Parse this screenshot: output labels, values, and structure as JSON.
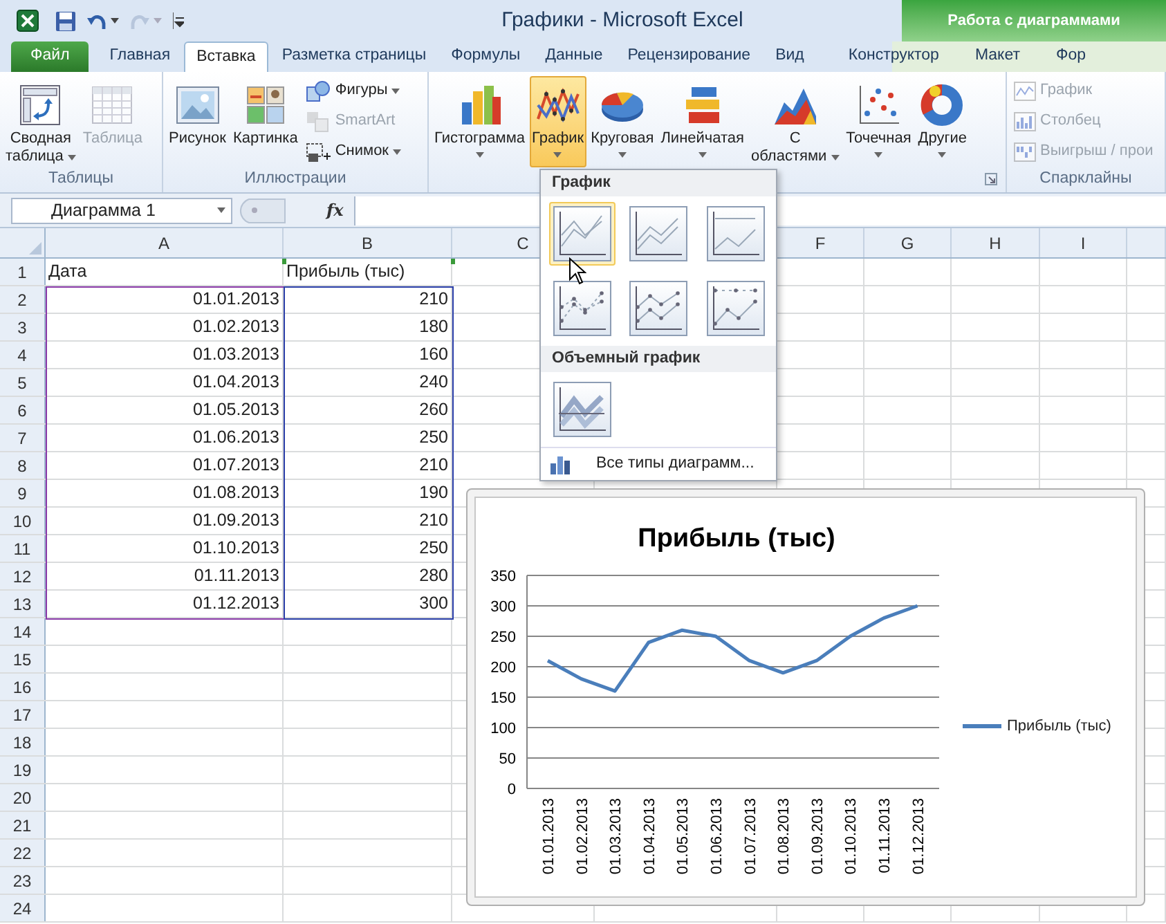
{
  "window": {
    "title": "Графики - Microsoft Excel",
    "context_header": "Работа с диаграммами"
  },
  "tabs": [
    {
      "label": "Файл",
      "kind": "file",
      "selected": false
    },
    {
      "label": "Главная",
      "kind": "normal",
      "selected": false
    },
    {
      "label": "Вставка",
      "kind": "normal",
      "selected": true
    },
    {
      "label": "Разметка страницы",
      "kind": "normal",
      "selected": false
    },
    {
      "label": "Формулы",
      "kind": "normal",
      "selected": false
    },
    {
      "label": "Данные",
      "kind": "normal",
      "selected": false
    },
    {
      "label": "Рецензирование",
      "kind": "normal",
      "selected": false
    },
    {
      "label": "Вид",
      "kind": "normal",
      "selected": false
    },
    {
      "label": "Конструктор",
      "kind": "context",
      "selected": false
    },
    {
      "label": "Макет",
      "kind": "context",
      "selected": false
    },
    {
      "label": "Фор",
      "kind": "context",
      "selected": false
    }
  ],
  "ribbon": {
    "groups": [
      {
        "label": "Таблицы",
        "items": [
          {
            "label": "Сводная\nтаблица",
            "kind": "large",
            "menu": true,
            "disabled": false,
            "selected": false
          },
          {
            "label": "Таблица",
            "kind": "large",
            "disabled": true,
            "selected": false
          }
        ]
      },
      {
        "label": "Иллюстрации",
        "items": [
          {
            "label": "Рисунок",
            "kind": "large",
            "disabled": false,
            "selected": false
          },
          {
            "label": "Картинка",
            "kind": "large",
            "disabled": false,
            "selected": false
          },
          {
            "label": "Фигуры",
            "kind": "small",
            "menu": true,
            "disabled": false
          },
          {
            "label": "SmartArt",
            "kind": "small",
            "disabled": true
          },
          {
            "label": "Снимок",
            "kind": "small",
            "menu": true,
            "disabled": false
          }
        ]
      },
      {
        "launcher": true,
        "items": [
          {
            "label": "Гистограмма",
            "kind": "large",
            "menu": true,
            "disabled": false,
            "selected": false
          },
          {
            "label": "График",
            "kind": "large",
            "menu": true,
            "disabled": false,
            "selected": true
          },
          {
            "label": "Круговая",
            "kind": "large",
            "menu": true,
            "disabled": false,
            "selected": false
          },
          {
            "label": "Линейчатая",
            "kind": "large",
            "menu": true,
            "disabled": false,
            "selected": false
          },
          {
            "label": "С\nобластями",
            "kind": "large",
            "menu": true,
            "disabled": false,
            "selected": false
          },
          {
            "label": "Точечная",
            "kind": "large",
            "menu": true,
            "disabled": false,
            "selected": false
          },
          {
            "label": "Другие",
            "kind": "large",
            "menu": true,
            "disabled": false,
            "selected": false
          }
        ]
      },
      {
        "label": "Спарклайны",
        "items": [
          {
            "label": "График",
            "kind": "small",
            "disabled": true
          },
          {
            "label": "Столбец",
            "kind": "small",
            "disabled": true
          },
          {
            "label": "Выигрыш / прои",
            "kind": "small",
            "disabled": true
          }
        ]
      }
    ]
  },
  "formula_bar": {
    "name_box": "Диаграмма 1",
    "fx": "fx"
  },
  "sheet": {
    "columns": [
      {
        "label": "A"
      },
      {
        "label": "B"
      },
      {
        "label": "C"
      },
      {
        "label": "F"
      },
      {
        "label": "G"
      },
      {
        "label": "H"
      },
      {
        "label": "I"
      }
    ],
    "row_numbers": [
      "1",
      "2",
      "3",
      "4",
      "5",
      "6",
      "7",
      "8",
      "9",
      "10",
      "11",
      "12",
      "13",
      "14",
      "15",
      "16",
      "17",
      "18",
      "19",
      "20",
      "21",
      "22",
      "23",
      "24"
    ],
    "rows": [
      [
        "Дата",
        "Прибыль (тыс)"
      ],
      [
        "01.01.2013",
        "210"
      ],
      [
        "01.02.2013",
        "180"
      ],
      [
        "01.03.2013",
        "160"
      ],
      [
        "01.04.2013",
        "240"
      ],
      [
        "01.05.2013",
        "260"
      ],
      [
        "01.06.2013",
        "250"
      ],
      [
        "01.07.2013",
        "210"
      ],
      [
        "01.08.2013",
        "190"
      ],
      [
        "01.09.2013",
        "210"
      ],
      [
        "01.10.2013",
        "250"
      ],
      [
        "01.11.2013",
        "280"
      ],
      [
        "01.12.2013",
        "300"
      ]
    ]
  },
  "dropdown": {
    "sections": [
      {
        "title": "График",
        "options": [
          {
            "selected": true
          },
          {
            "selected": false
          },
          {
            "selected": false
          },
          {
            "selected": false
          },
          {
            "selected": false
          },
          {
            "selected": false
          }
        ]
      },
      {
        "title": "Объемный график",
        "options": [
          {
            "selected": false
          }
        ]
      }
    ],
    "footer": "Все типы диаграмм..."
  },
  "chart": {
    "chart_data": {
      "type": "line",
      "title": "Прибыль (тыс)",
      "categories": [
        "01.01.2013",
        "01.02.2013",
        "01.03.2013",
        "01.04.2013",
        "01.05.2013",
        "01.06.2013",
        "01.07.2013",
        "01.08.2013",
        "01.09.2013",
        "01.10.2013",
        "01.11.2013",
        "01.12.2013"
      ],
      "series": [
        {
          "name": "Прибыль (тыс)",
          "color": "#4a7ebb",
          "values": [
            210,
            180,
            160,
            240,
            260,
            250,
            210,
            190,
            210,
            250,
            280,
            300
          ]
        }
      ],
      "ylim": [
        0,
        350
      ],
      "grid": true,
      "yticks": [
        0,
        50,
        100,
        150,
        200,
        250,
        300,
        350
      ]
    }
  }
}
